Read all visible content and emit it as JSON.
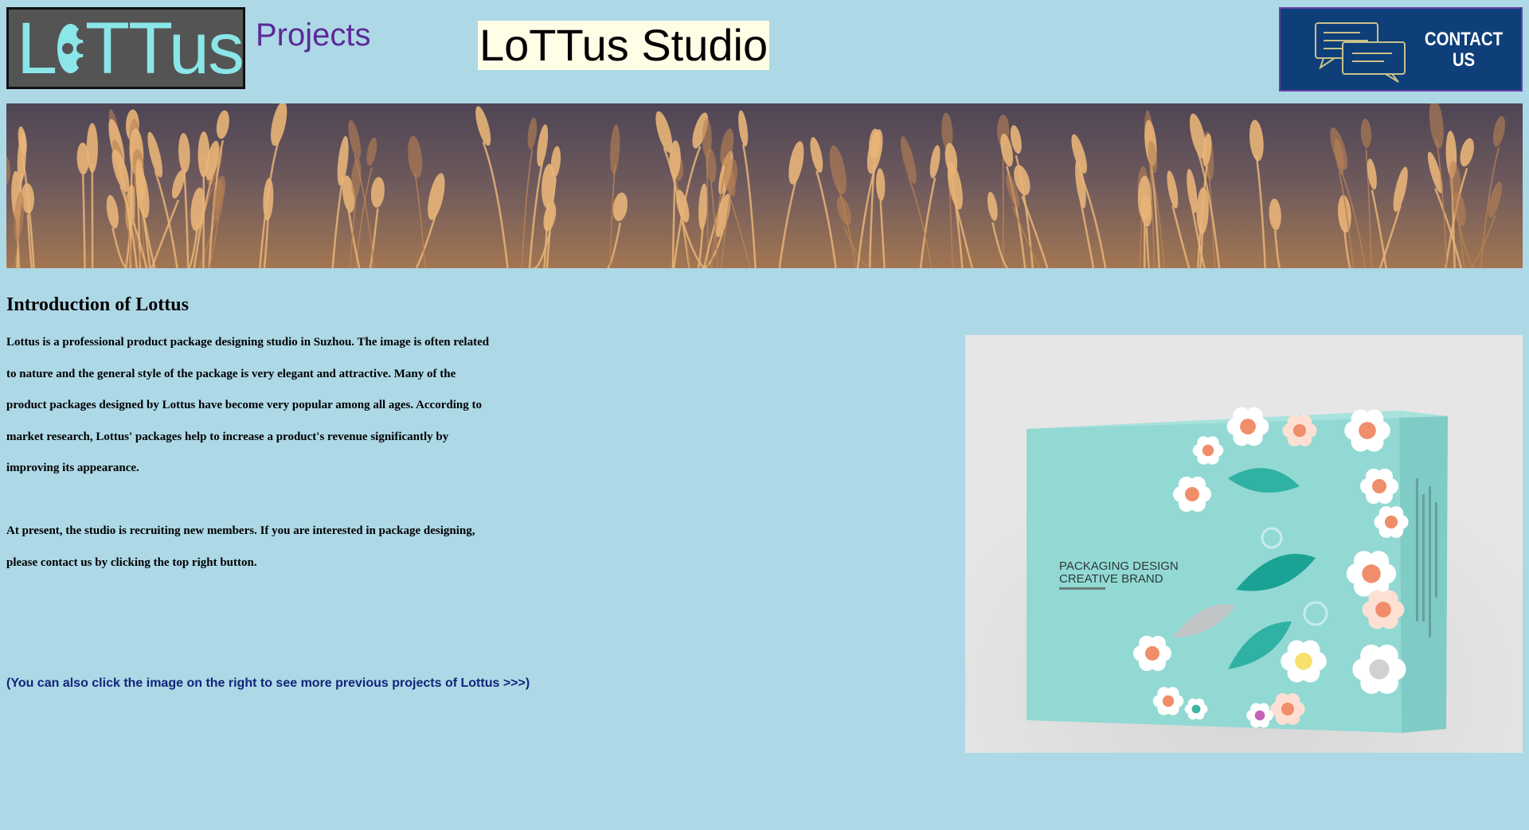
{
  "header": {
    "logo_text": "LoTTus",
    "projects_link": "Projects",
    "title": "LoTTus Studio",
    "contact_button": {
      "line1": "CONTACT",
      "line2": "US",
      "icon": "chat-bubbles-icon"
    }
  },
  "banner": {
    "image": "wheat-field-banner"
  },
  "intro": {
    "heading": "Introduction of Lottus",
    "paragraph1": "Lottus is a professional product package designing studio in Suzhou. The image is often related to nature and the general style of the package is very elegant and attractive. Many of the product packages designed by Lottus have become very popular among all ages. According to market research, Lottus' packages help to increase a product's revenue significantly by improving its appearance.",
    "paragraph2": "At present, the studio is recruiting new members. If you are interested in package designing, please contact us by clicking the top right button.",
    "hint": "(You can also click the image on the right to see more previous projects of Lottus >>>)"
  },
  "project_image": {
    "line1": "PACKAGING DESIGN",
    "line2": "CREATIVE BRAND"
  },
  "colors": {
    "page_background": "#add8e6",
    "projects_link": "#5b2a98",
    "title_highlight": "#fffde6",
    "contact_background": "#0e3f79",
    "hint_text": "#12247a",
    "box_teal": "#93d9d3"
  }
}
